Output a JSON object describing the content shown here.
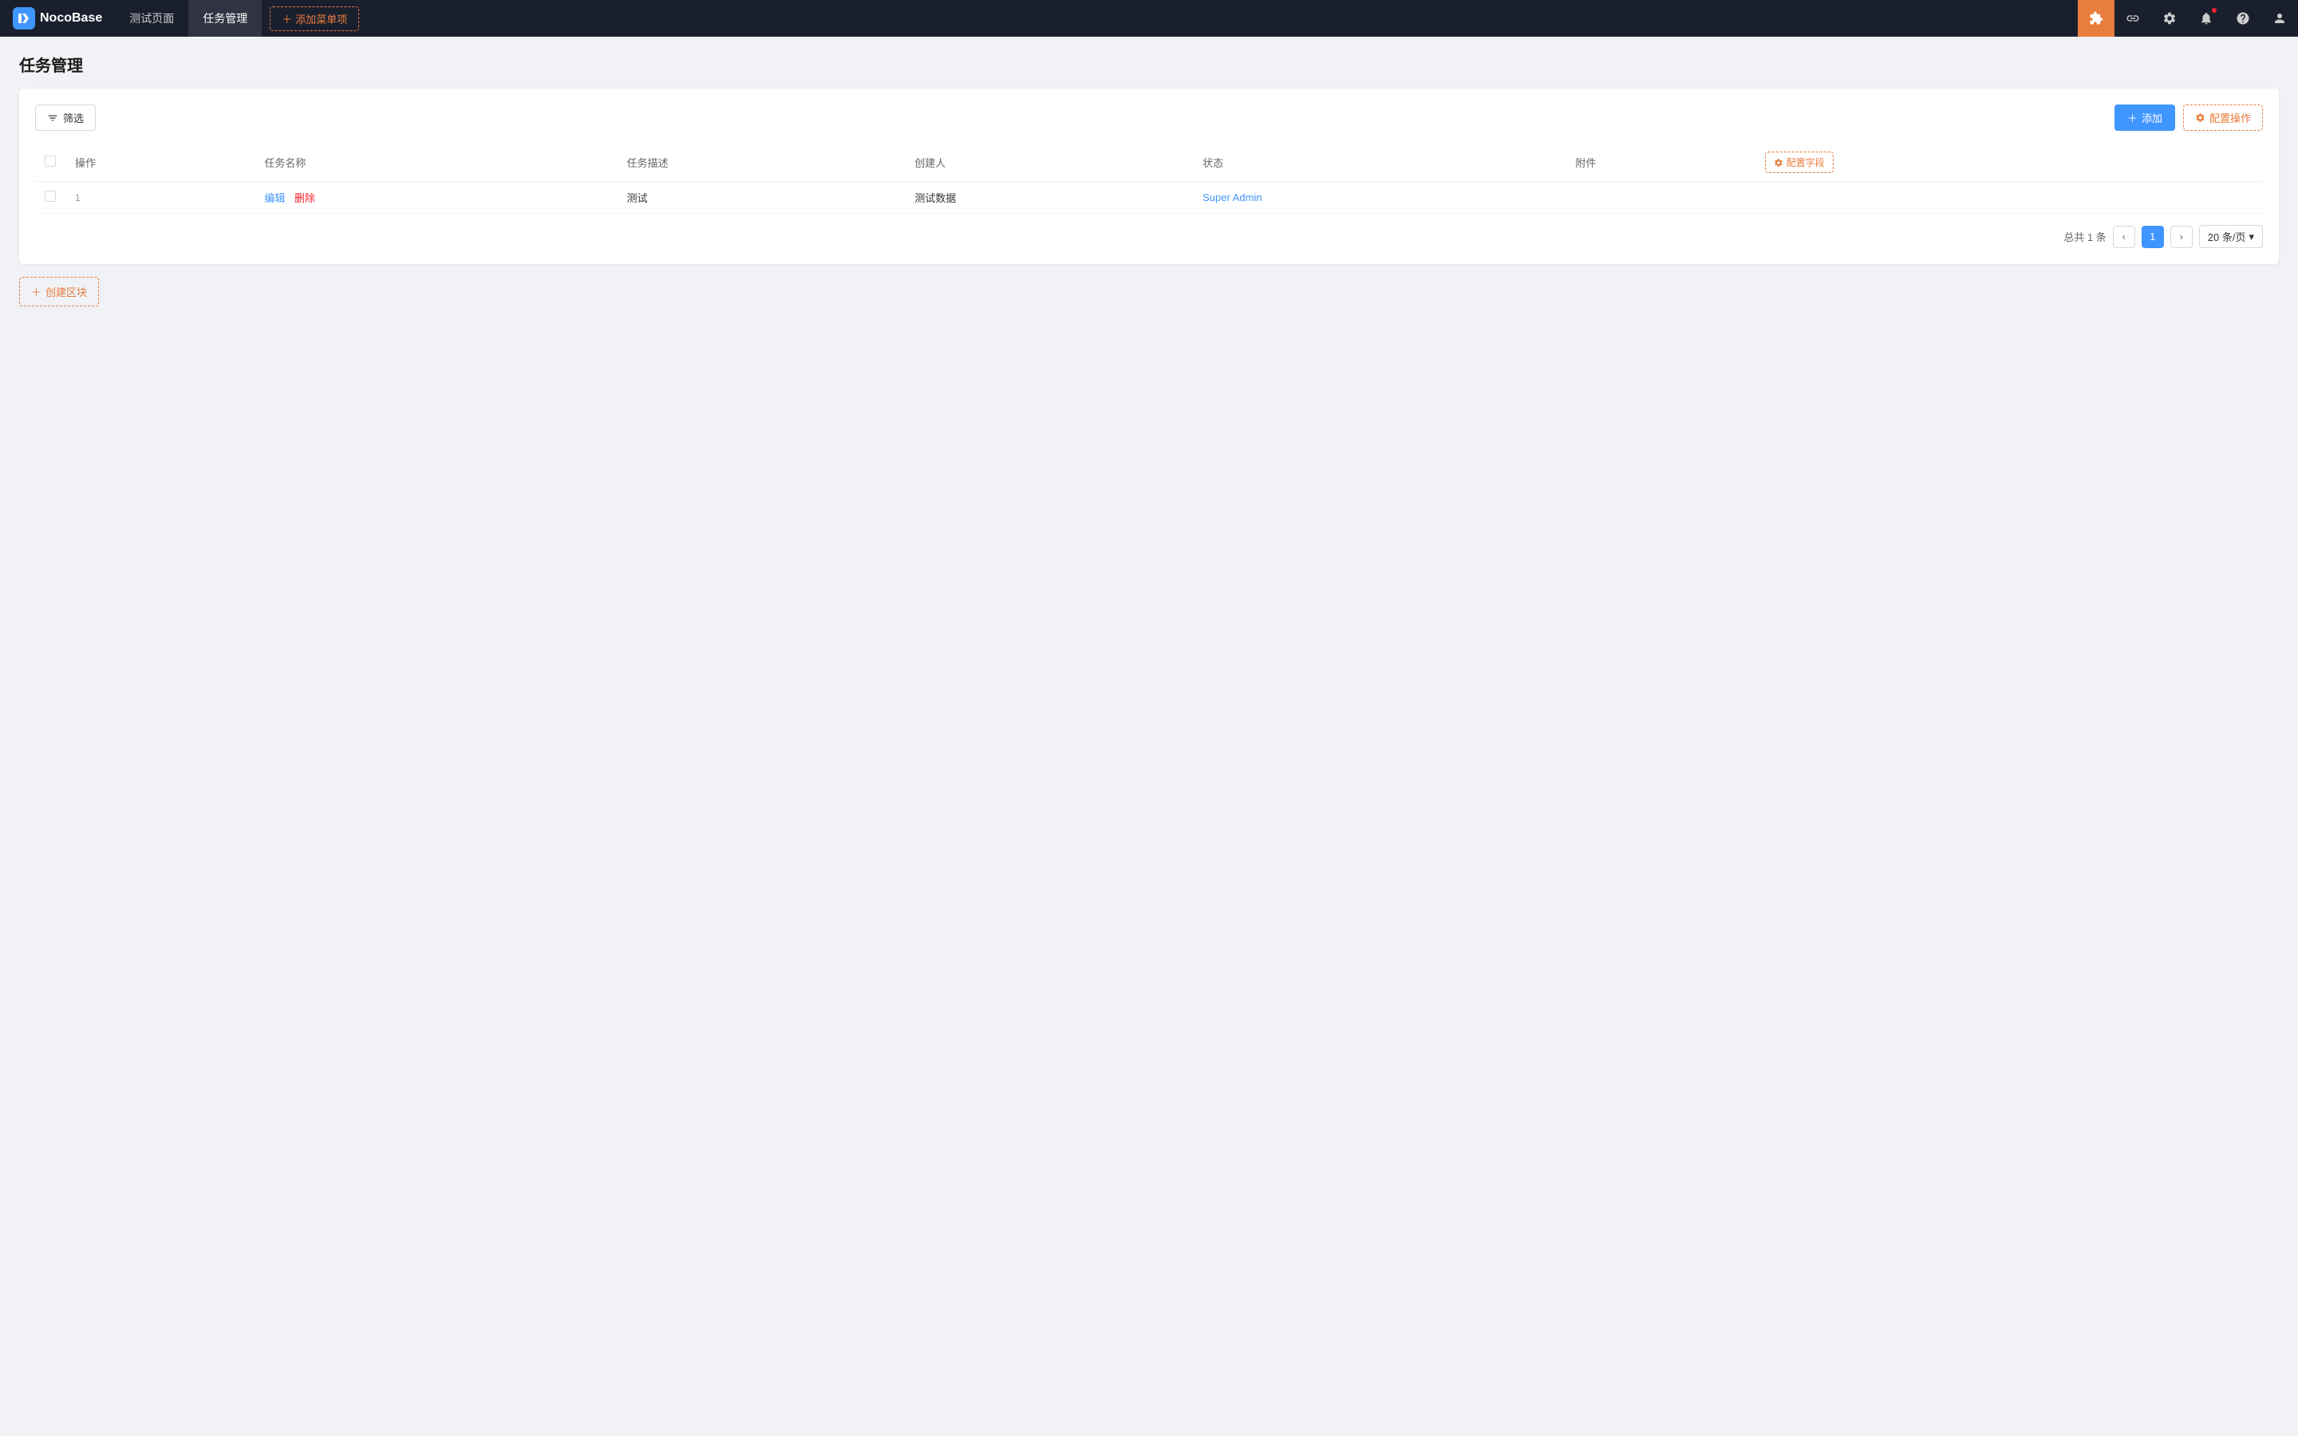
{
  "app": {
    "name": "NocoBase"
  },
  "navbar": {
    "tabs": [
      {
        "id": "test",
        "label": "测试页面",
        "active": false
      },
      {
        "id": "task",
        "label": "任务管理",
        "active": true
      }
    ],
    "add_menu_label": "添加菜单项",
    "icons": {
      "plugin": "🧩",
      "link": "🔗",
      "settings": "⚙",
      "notification": "🔔",
      "help": "❓",
      "user": "👤"
    }
  },
  "page": {
    "title": "任务管理"
  },
  "toolbar": {
    "filter_label": "筛选",
    "add_label": "添加",
    "config_ops_label": "配置操作"
  },
  "table": {
    "columns": [
      {
        "id": "ops",
        "label": "操作"
      },
      {
        "id": "task_name",
        "label": "任务名称"
      },
      {
        "id": "task_desc",
        "label": "任务描述"
      },
      {
        "id": "creator",
        "label": "创建人"
      },
      {
        "id": "status",
        "label": "状态"
      },
      {
        "id": "attachment",
        "label": "附件"
      }
    ],
    "config_fields_label": "配置字段",
    "rows": [
      {
        "index": 1,
        "task_name": "测试",
        "task_desc": "测试数据",
        "creator": "Super Admin",
        "status": "",
        "attachment": "",
        "edit_label": "编辑",
        "delete_label": "删除"
      }
    ]
  },
  "pagination": {
    "total_label": "总共 1 条",
    "prev_label": "<",
    "next_label": ">",
    "current_page": 1,
    "page_size_label": "20 条/页"
  },
  "create_block": {
    "label": "创建区块"
  }
}
